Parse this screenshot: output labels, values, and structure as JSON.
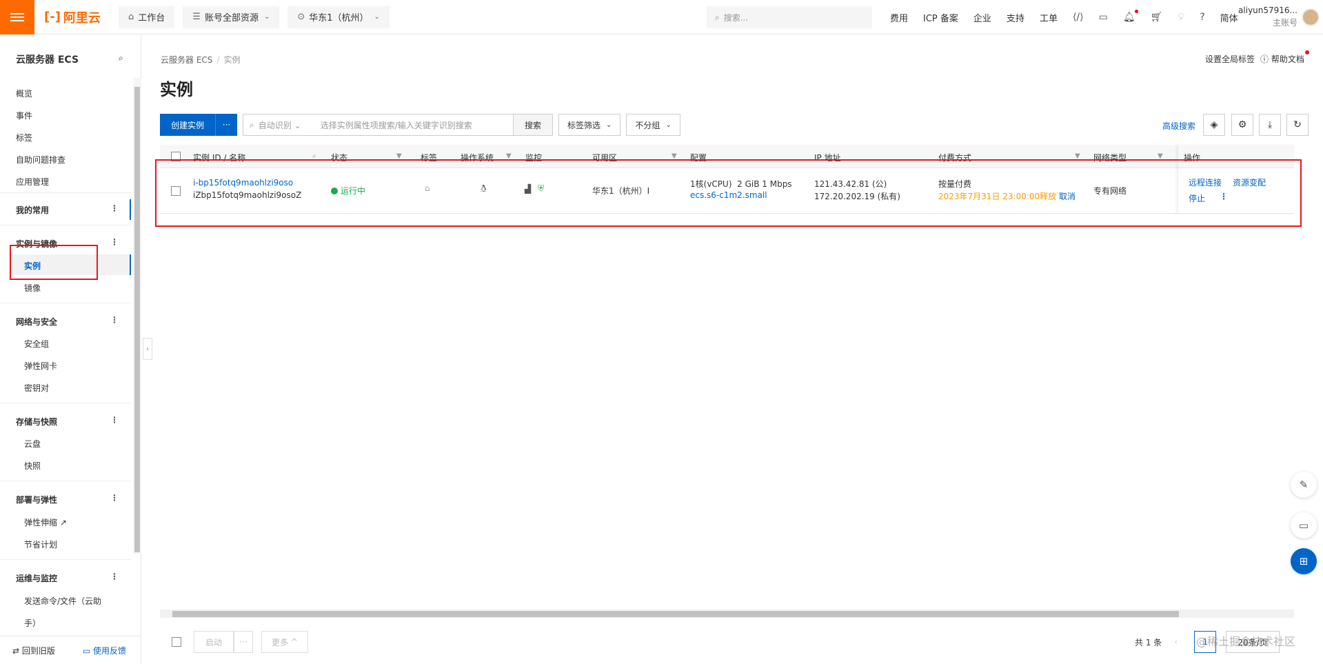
{
  "topbar": {
    "logo": "阿里云",
    "workbench": "工作台",
    "resources": "账号全部资源",
    "region": "华东1（杭州）",
    "search_placeholder": "搜索...",
    "links": [
      "费用",
      "ICP 备案",
      "企业",
      "支持",
      "工单"
    ],
    "lang": "简体",
    "user_name": "aliyun57916...",
    "user_role": "主账号"
  },
  "sidebar": {
    "title": "云服务器 ECS",
    "items": [
      "概览",
      "事件",
      "标签",
      "自助问题排查",
      "应用管理"
    ],
    "favorites": "我的常用",
    "groups": [
      {
        "label": "实例与镜像",
        "children": [
          "实例",
          "镜像"
        ]
      },
      {
        "label": "网络与安全",
        "children": [
          "安全组",
          "弹性网卡",
          "密钥对"
        ]
      },
      {
        "label": "存储与快照",
        "children": [
          "云盘",
          "快照"
        ]
      },
      {
        "label": "部署与弹性",
        "children": [
          "弹性伸缩",
          "节省计划"
        ]
      },
      {
        "label": "运维与监控",
        "children": [
          "发送命令/文件（云助",
          "手）"
        ]
      }
    ],
    "footer_back": "回到旧版",
    "footer_feedback": "使用反馈"
  },
  "breadcrumb": {
    "root": "云服务器 ECS",
    "current": "实例"
  },
  "page_title": "实例",
  "header_links": {
    "global_tags": "设置全局标签",
    "help": "帮助文档"
  },
  "toolbar": {
    "create": "创建实例",
    "more": "···",
    "auto_detect": "自动识别",
    "search_placeholder": "选择实例属性项搜索/输入关键字识别搜索",
    "search_btn": "搜索",
    "tag_filter": "标签筛选",
    "group": "不分组",
    "advanced_search": "高级搜索"
  },
  "table": {
    "headers": [
      "实例 ID / 名称",
      "状态",
      "标签",
      "操作系统",
      "监控",
      "可用区",
      "配置",
      "IP 地址",
      "付费方式",
      "网络类型",
      "操作"
    ],
    "rows": [
      {
        "id": "i-bp15fotq9maohlzi9oso",
        "name": "iZbp15fotq9maohlzi9osoZ",
        "status": "运行中",
        "zone": "华东1（杭州）I",
        "config_cpu": "1核(vCPU)",
        "config_mem": "2 GiB 1 Mbps",
        "config_type": "ecs.s6-c1m2.small",
        "ip_public": "121.43.42.81 (公)",
        "ip_private": "172.20.202.19 (私有)",
        "billing": "按量付费",
        "release": "2023年7月31日 23:00:00释放",
        "cancel": "取消",
        "network": "专有网络",
        "ops": [
          "远程连接",
          "资源变配",
          "停止"
        ]
      }
    ]
  },
  "footer": {
    "start": "启动",
    "more_dots": "···",
    "more": "更多",
    "total": "共 1 条",
    "page": "1",
    "page_size": "20条/页"
  },
  "watermark": "@稀土掘金技术社区"
}
